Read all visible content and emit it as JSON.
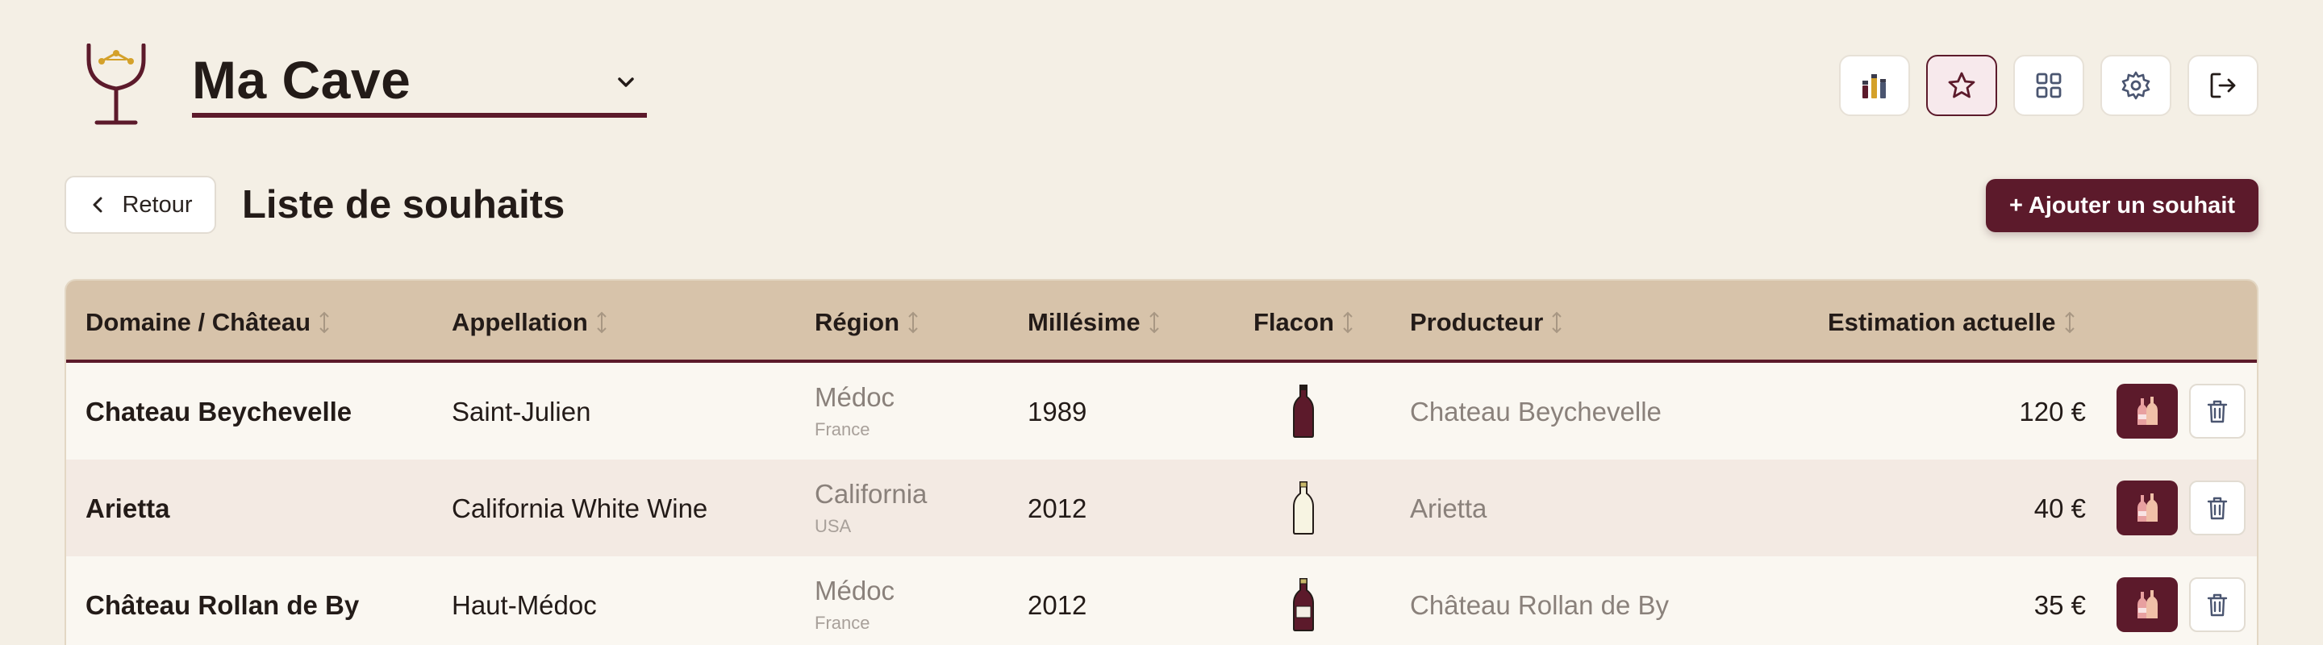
{
  "header": {
    "cellar_name": "Ma Cave",
    "toolbar": [
      {
        "name": "stats-button",
        "icon": "bar-chart-icon",
        "active": false
      },
      {
        "name": "wishlist-button",
        "icon": "star-icon",
        "active": true
      },
      {
        "name": "grid-view-button",
        "icon": "grid-icon",
        "active": false
      },
      {
        "name": "settings-button",
        "icon": "gear-icon",
        "active": false
      },
      {
        "name": "logout-button",
        "icon": "logout-icon",
        "active": false
      }
    ]
  },
  "page": {
    "back_label": "Retour",
    "title": "Liste de souhaits",
    "add_label": "+ Ajouter un souhait"
  },
  "table": {
    "columns": [
      "Domaine / Château",
      "Appellation",
      "Région",
      "Millésime",
      "Flacon",
      "Producteur",
      "Estimation actuelle"
    ],
    "rows": [
      {
        "domain": "Chateau Beychevelle",
        "appellation": "Saint-Julien",
        "region": "Médoc",
        "country": "France",
        "vintage": "1989",
        "bottle": "red",
        "producer": "Chateau Beychevelle",
        "estimate": "120 €"
      },
      {
        "domain": "Arietta",
        "appellation": "California White Wine",
        "region": "California",
        "country": "USA",
        "vintage": "2012",
        "bottle": "white",
        "producer": "Arietta",
        "estimate": "40 €"
      },
      {
        "domain": "Château Rollan de By",
        "appellation": "Haut-Médoc",
        "region": "Médoc",
        "country": "France",
        "vintage": "2012",
        "bottle": "red",
        "producer": "Château Rollan de By",
        "estimate": "35 €"
      }
    ]
  },
  "colors": {
    "accent": "#5c1a2b",
    "background": "#f4efe5",
    "header_row": "#d7c3aa",
    "logo_gold": "#d4a12a"
  }
}
